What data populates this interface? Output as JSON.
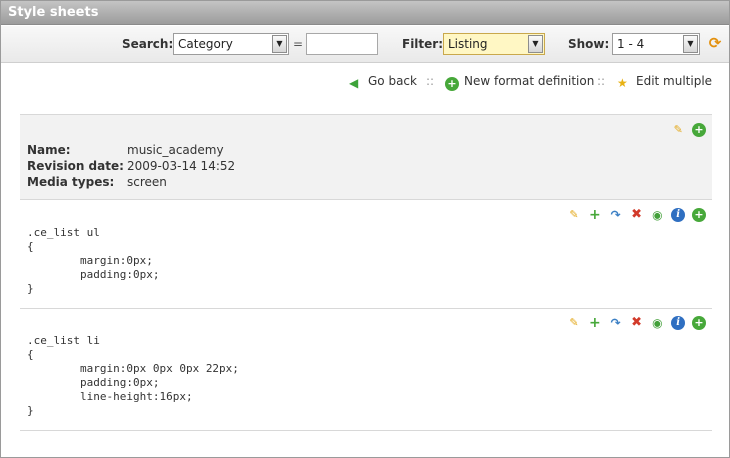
{
  "window": {
    "title": "Style sheets"
  },
  "search": {
    "label": "Search:",
    "field_value": "Category",
    "equals": "=",
    "text_value": "",
    "filter_label": "Filter:",
    "filter_value": "Listing",
    "show_label": "Show:",
    "show_value": "1 - 4"
  },
  "actions": {
    "go_back": "Go back",
    "separator": "::",
    "new_format": "New format definition",
    "edit_multiple": "Edit multiple"
  },
  "info": {
    "name_label": "Name:",
    "name_value": "music_academy",
    "revision_label": "Revision date:",
    "revision_value": "2009-03-14 14:52",
    "media_label": "Media types:",
    "media_value": "screen"
  },
  "blocks": [
    {
      "code": ".ce_list ul\n{\n\tmargin:0px;\n\tpadding:0px;\n}"
    },
    {
      "code": ".ce_list li\n{\n\tmargin:0px 0px 0px 22px;\n\tpadding:0px;\n\tline-height:16px;\n}"
    }
  ],
  "icons": {
    "pencil": "✎",
    "plus": "+",
    "circle_plus": "+",
    "copy": "↷",
    "delete": "✖",
    "preview": "◉",
    "info": "i",
    "refresh": "⟳",
    "back": "◀",
    "star": "★",
    "arrow": "▼"
  },
  "colors": {
    "title_bar": "#9c9c9c",
    "filter_highlight": "#fff7c4",
    "green": "#47a83a",
    "red": "#d23a2a",
    "blue": "#2f6fc1"
  }
}
